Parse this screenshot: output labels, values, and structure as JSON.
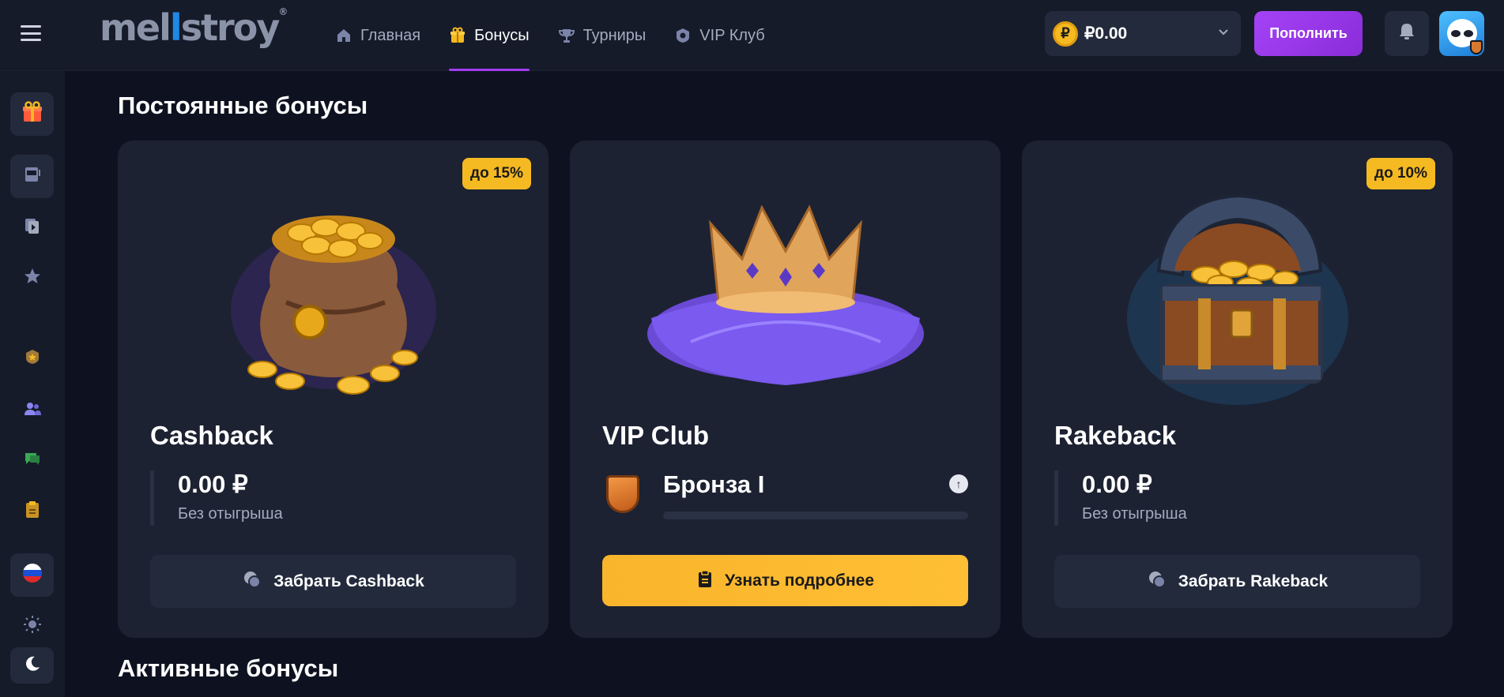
{
  "logo": {
    "text_a": "mel",
    "text_b": "l",
    "text_c": "stroy",
    "tm": "®"
  },
  "nav": [
    {
      "label": "Главная",
      "icon": "home-icon"
    },
    {
      "label": "Бонусы",
      "icon": "gift-icon",
      "active": true
    },
    {
      "label": "Турниры",
      "icon": "trophy-icon"
    },
    {
      "label": "VIP Клуб",
      "icon": "vip-badge-icon"
    }
  ],
  "wallet": {
    "currency_symbol": "₽",
    "balance": "₽0.00"
  },
  "deposit_label": "Пополнить",
  "colors": {
    "accent": "#a13bf0",
    "gold": "#f5b921",
    "bg": "#0e1220",
    "panel": "#1c2232"
  },
  "sidebar": [
    {
      "icon": "gift-icon"
    },
    {
      "icon": "slot-machine-icon"
    },
    {
      "icon": "live-casino-icon"
    },
    {
      "icon": "star-icon"
    },
    {
      "icon": "vip-badge-icon"
    },
    {
      "icon": "users-icon"
    },
    {
      "icon": "chat-icon"
    },
    {
      "icon": "clipboard-icon"
    },
    {
      "icon": "russia-flag-icon"
    },
    {
      "icon": "sun-icon"
    },
    {
      "icon": "moon-icon"
    }
  ],
  "permanent_title": "Постоянные бонусы",
  "active_title": "Активные бонусы",
  "cards": {
    "cashback": {
      "tag": "до 15%",
      "title": "Cashback",
      "value": "0.00 ₽",
      "sub": "Без отыгрыша",
      "button": "Забрать Cashback"
    },
    "vip": {
      "title": "VIP Club",
      "rank": "Бронза I",
      "progress": 0,
      "button": "Узнать подробнее"
    },
    "rakeback": {
      "tag": "до 10%",
      "title": "Rakeback",
      "value": "0.00 ₽",
      "sub": "Без отыгрыша",
      "button": "Забрать Rakeback"
    }
  }
}
